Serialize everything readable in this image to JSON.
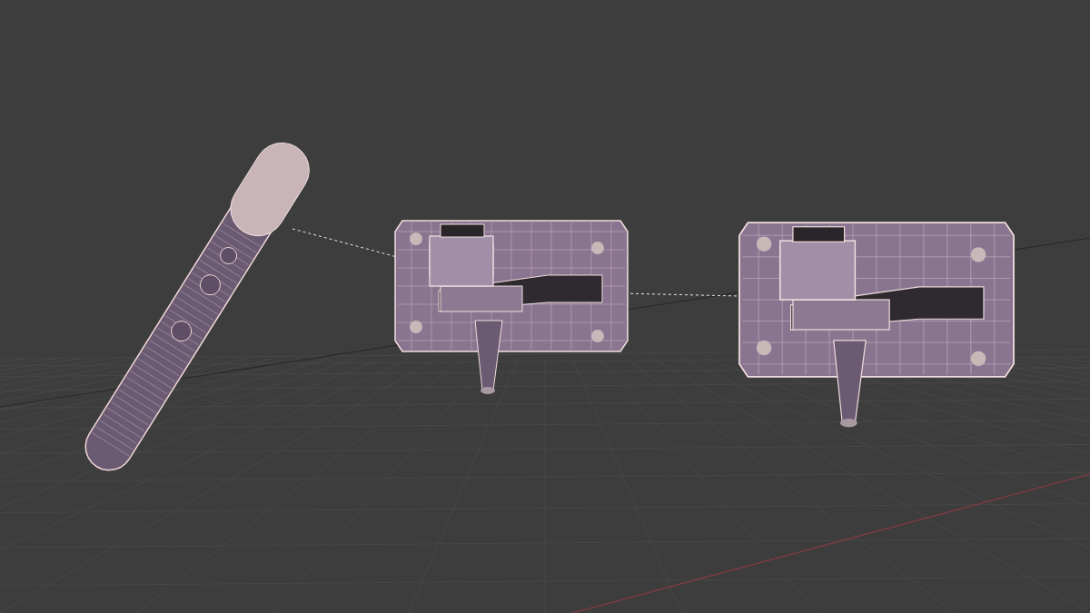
{
  "viewport": {
    "objects": [
      {
        "kind": "handle"
      },
      {
        "kind": "mount"
      },
      {
        "kind": "mount"
      }
    ],
    "relationship_lines": true
  }
}
